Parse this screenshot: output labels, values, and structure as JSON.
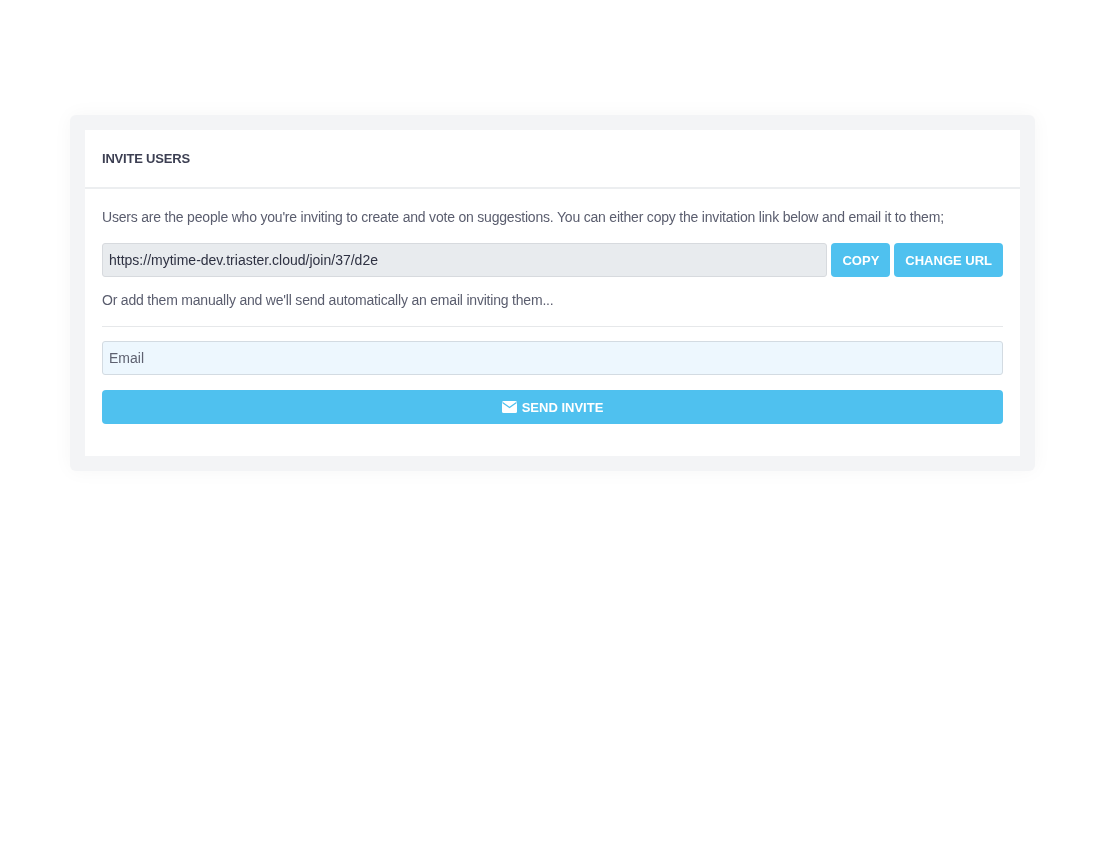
{
  "card": {
    "title": "INVITE USERS",
    "intro": "Users are the people who you're inviting to create and vote on suggestions. You can either copy the invitation link below and email it to them;",
    "link_field": {
      "value": "https://mytime-dev.triaster.cloud/join/37/d2e"
    },
    "link_buttons": [
      "COPY",
      "CHANGE URL"
    ],
    "manual_note": "Or add them manually and we'll send automatically an email inviting them...",
    "email_field": {
      "placeholder": "Email"
    },
    "send_button": "SEND INVITE"
  }
}
